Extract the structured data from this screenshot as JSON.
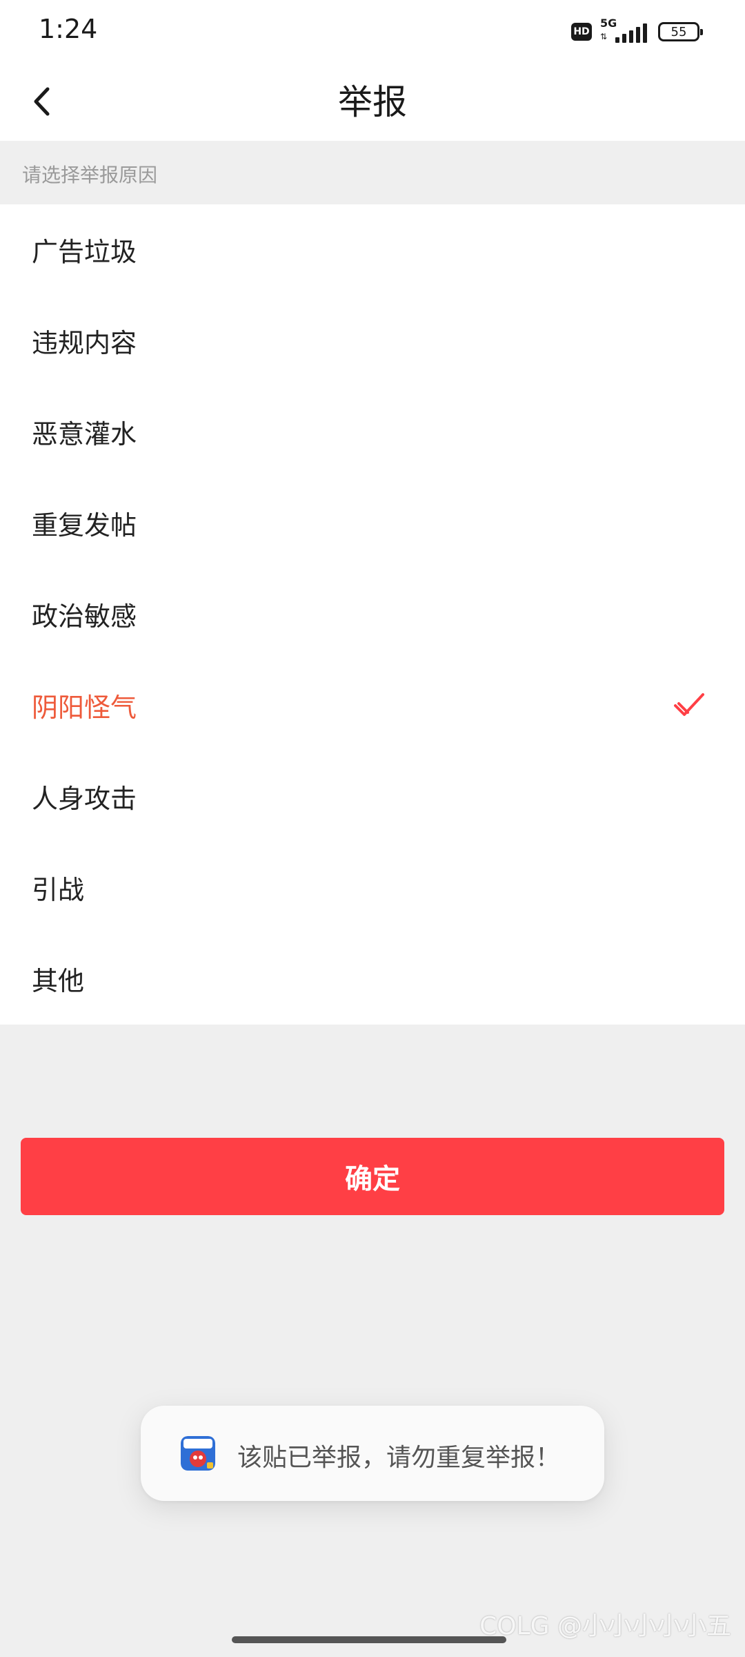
{
  "status_bar": {
    "time": "1:24",
    "hd": "HD",
    "network": "5G",
    "battery": "55"
  },
  "nav": {
    "title": "举报",
    "back_icon": "chevron-left-icon"
  },
  "hint": "请选择举报原因",
  "reasons": [
    {
      "label": "广告垃圾",
      "selected": false
    },
    {
      "label": "违规内容",
      "selected": false
    },
    {
      "label": "恶意灌水",
      "selected": false
    },
    {
      "label": "重复发帖",
      "selected": false
    },
    {
      "label": "政治敏感",
      "selected": false
    },
    {
      "label": "阴阳怪气",
      "selected": true
    },
    {
      "label": "人身攻击",
      "selected": false
    },
    {
      "label": "引战",
      "selected": false
    },
    {
      "label": "其他",
      "selected": false
    }
  ],
  "confirm_label": "确定",
  "toast": {
    "message": "该贴已举报，请勿重复举报！",
    "icon": "colg-app-icon"
  },
  "watermark": "COLG @小小小小小五",
  "colors": {
    "accent_red": "#ff3f45",
    "selected_text": "#ee5a3a",
    "background": "#efefef"
  }
}
